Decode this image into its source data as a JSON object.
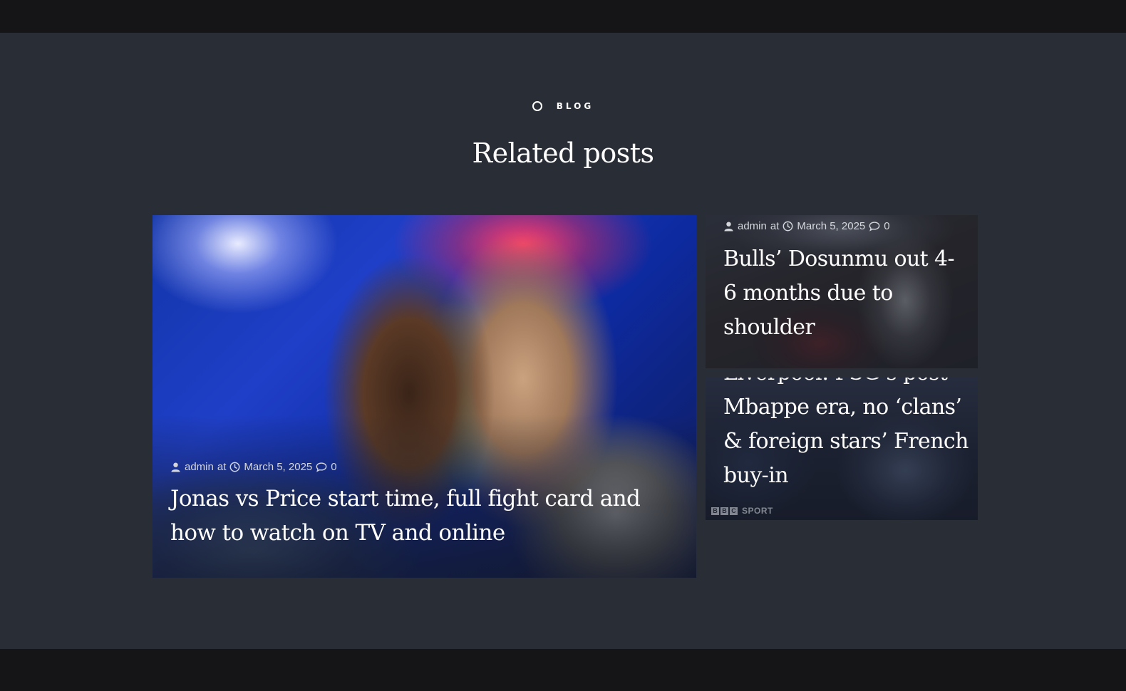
{
  "section": {
    "tag": "BLOG",
    "title": "Related posts"
  },
  "posts": [
    {
      "author": "admin",
      "at": "at",
      "date": "March 5, 2025",
      "comments": "0",
      "title": "Jonas vs Price start time, full fight card and how to watch on TV and online"
    },
    {
      "author": "admin",
      "at": "at",
      "date": "March 5, 2025",
      "comments": "0",
      "title": "Bulls’ Dosunmu out 4-6 months due to shoulder"
    },
    {
      "title": "Liverpool: PSG’s post-Mbappe era, no ‘clans’ & foreign stars’ French buy-in",
      "watermark": {
        "letters": [
          "B",
          "B",
          "C"
        ],
        "word": "SPORT"
      }
    }
  ],
  "colors": {
    "page_bg": "#292d36",
    "bar_bg": "#151517",
    "text": "#ffffff",
    "meta_text": "#d4d6dc"
  },
  "icons": {
    "tag": "circle-icon",
    "author": "user-icon",
    "date": "clock-icon",
    "comments": "comment-icon"
  }
}
